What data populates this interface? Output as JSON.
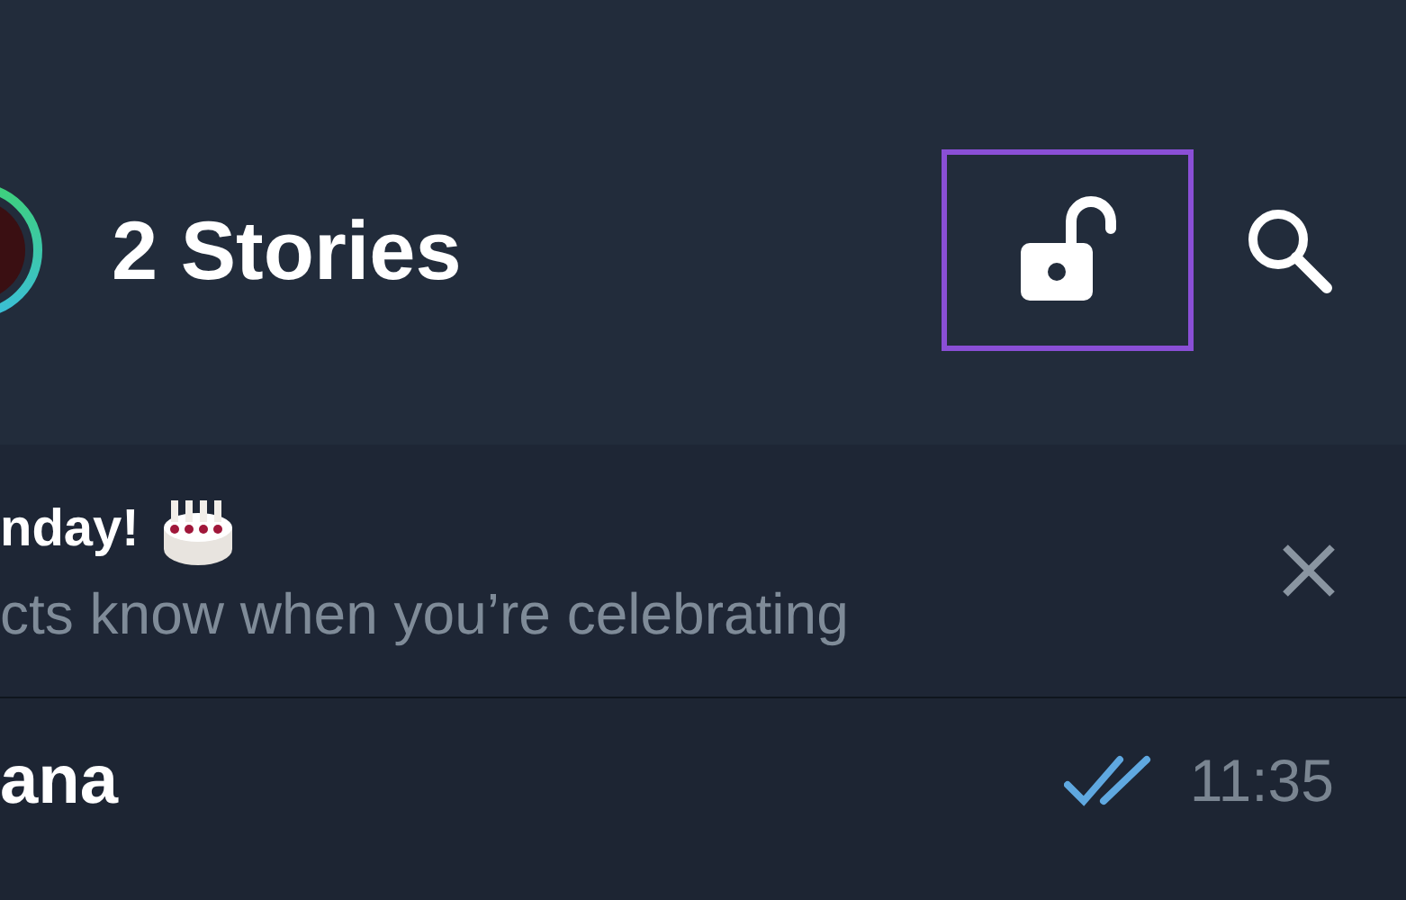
{
  "header": {
    "title": "2 Stories",
    "lock_highlighted": true
  },
  "banner": {
    "title": "nday!",
    "subtitle": "cts know when you’re celebrating"
  },
  "chat": {
    "name": "ana",
    "time": "11:35",
    "read": true
  }
}
